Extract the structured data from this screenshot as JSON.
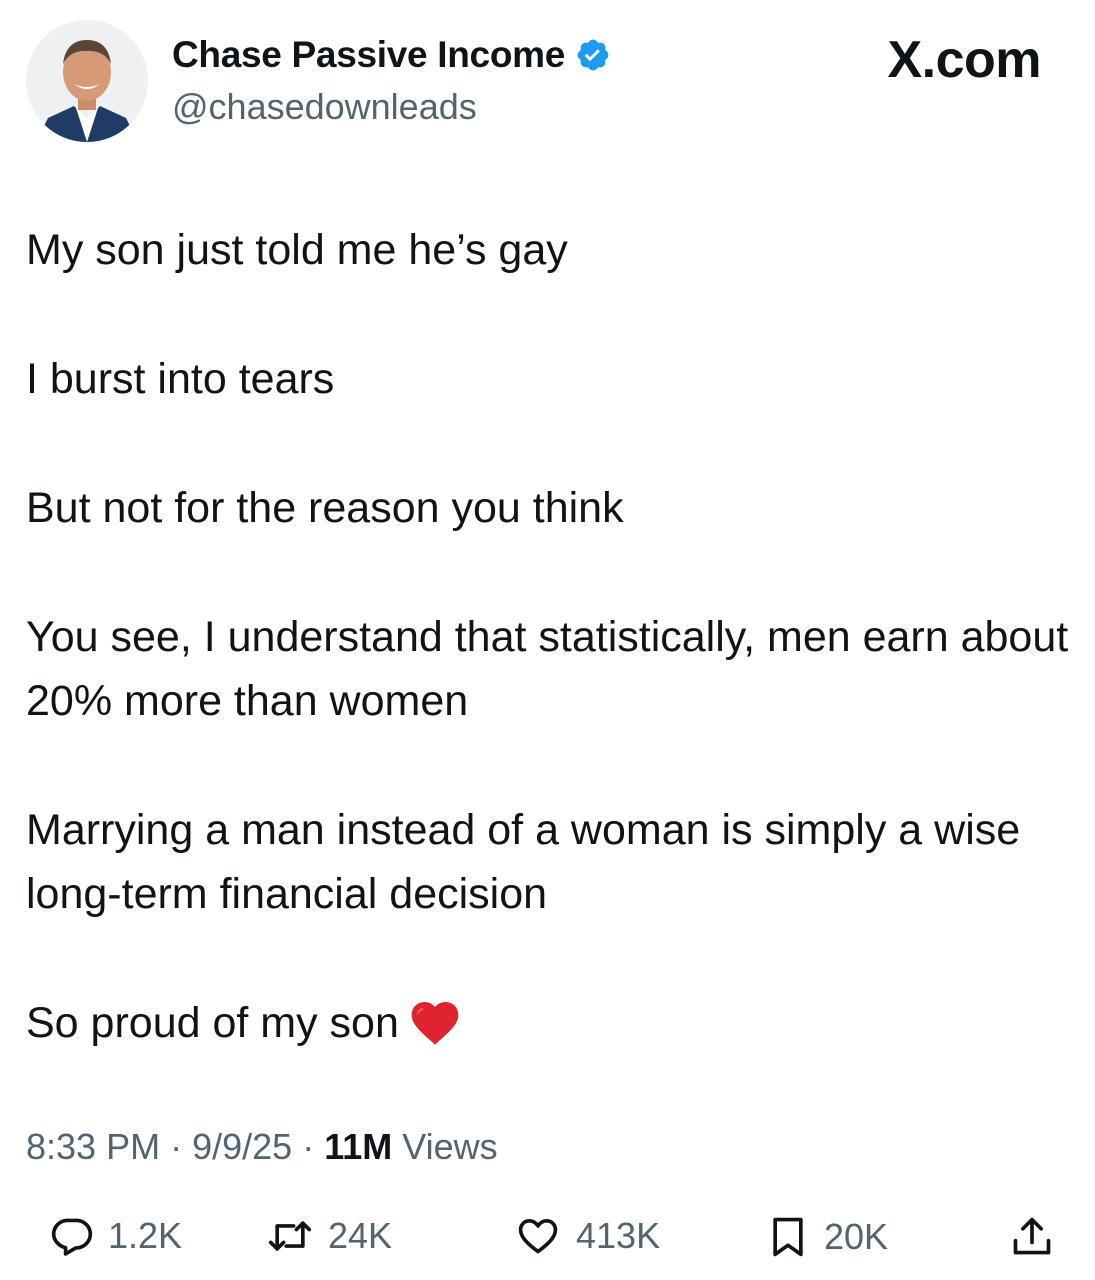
{
  "author": {
    "display_name": "Chase Passive Income",
    "handle": "@chasedownleads",
    "verified_color": "#1d9bf0"
  },
  "brand": "X.com",
  "tweet": {
    "paragraphs": [
      "My son just told me he’s gay",
      "I burst into tears",
      "But not for the reason you think",
      "You see, I understand that statistically, men earn about 20% more than women",
      "Marrying a man instead of a woman is simply a wise long-term financial decision",
      "So proud of my son"
    ],
    "emoji": "red-heart"
  },
  "meta": {
    "time": "8:33 PM",
    "date": "9/9/25",
    "views_count": "11M",
    "views_label": "Views"
  },
  "actions": {
    "replies": "1.2K",
    "reposts": "24K",
    "likes": "413K",
    "bookmarks": "20K"
  },
  "icons": [
    "verified-badge-icon",
    "reply-icon",
    "repost-icon",
    "like-icon",
    "bookmark-icon",
    "share-icon"
  ]
}
